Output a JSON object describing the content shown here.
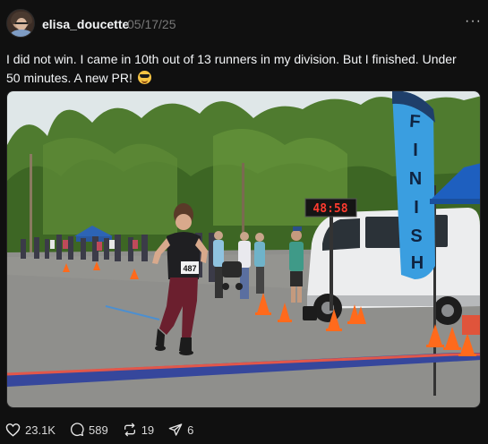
{
  "post": {
    "username": "elisa_doucette",
    "date": "05/17/25",
    "more_label": "···",
    "caption": "I did not win. I came in 10th out of 13 runners in my division. But I finished. Under 50 minutes. A new PR!",
    "caption_emoji": "smiling-face-with-sunglasses",
    "photo": {
      "finish_flag_text": "FINISH",
      "clock_display": "48:58",
      "bib_number": "487"
    },
    "actions": {
      "likes": "23.1K",
      "comments": "589",
      "reposts": "19",
      "shares": "6"
    }
  }
}
